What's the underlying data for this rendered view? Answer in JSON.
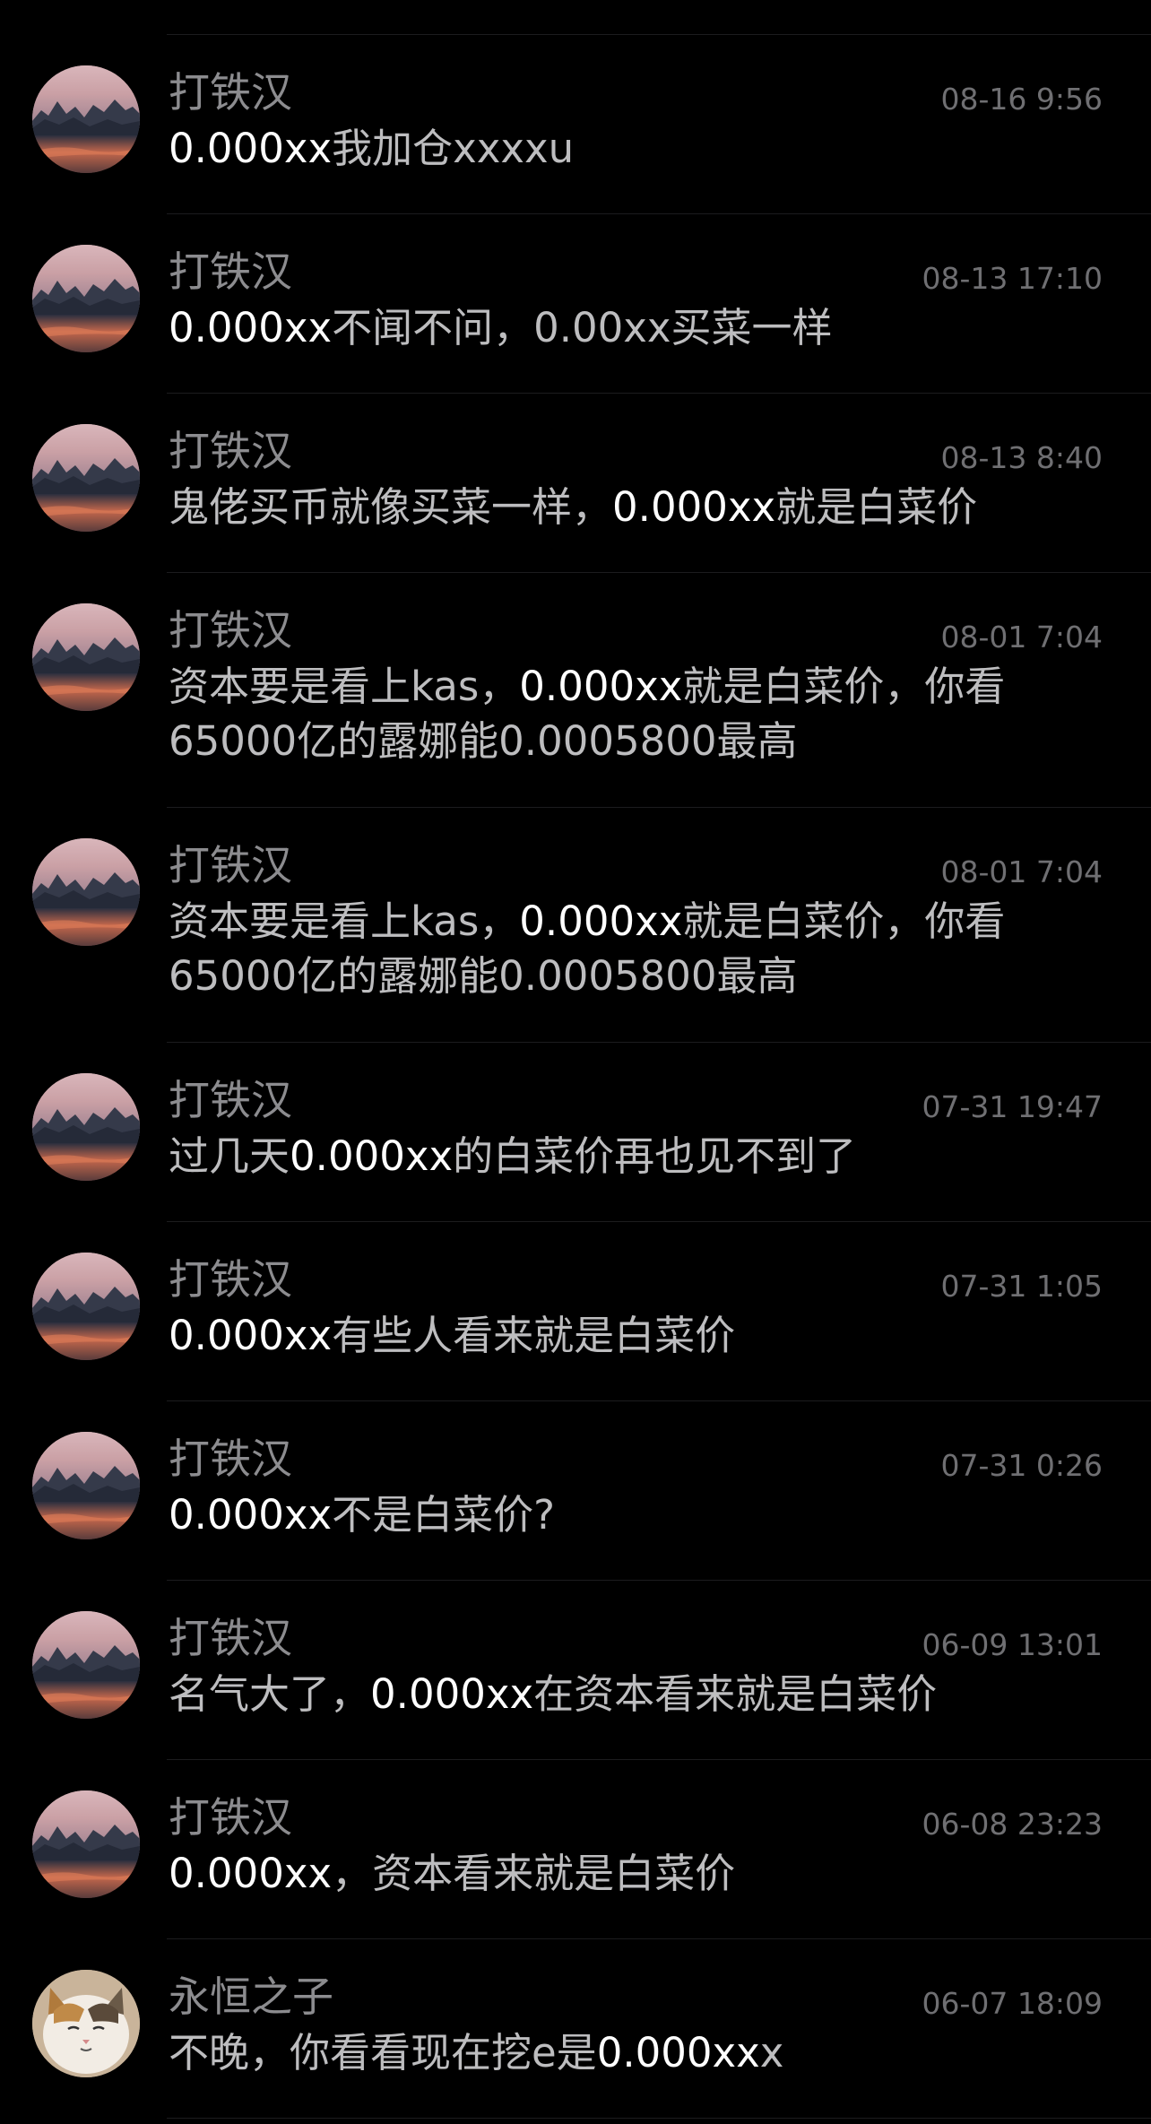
{
  "colors": {
    "background": "#000000",
    "divider": "#1c1c1e",
    "sender_text": "#8c8c8f",
    "time_text": "#6f6f72",
    "message_text": "#bdbdbf",
    "highlight_text": "#ffffff"
  },
  "messages": [
    {
      "sender": "打铁汉",
      "time": "08-16 9:56",
      "avatar": "landscape-avatar",
      "parts": [
        {
          "text": "0.000xx",
          "hl": true
        },
        {
          "text": "我加仓xxxxu",
          "hl": false
        }
      ]
    },
    {
      "sender": "打铁汉",
      "time": "08-13 17:10",
      "avatar": "landscape-avatar",
      "parts": [
        {
          "text": "0.000xx",
          "hl": true
        },
        {
          "text": "不闻不问，0.00xx买菜一样",
          "hl": false
        }
      ]
    },
    {
      "sender": "打铁汉",
      "time": "08-13 8:40",
      "avatar": "landscape-avatar",
      "parts": [
        {
          "text": "鬼佬买币就像买菜一样，",
          "hl": false
        },
        {
          "text": "0.000xx",
          "hl": true
        },
        {
          "text": "就是白菜价",
          "hl": false
        }
      ]
    },
    {
      "sender": "打铁汉",
      "time": "08-01 7:04",
      "avatar": "landscape-avatar",
      "parts": [
        {
          "text": "资本要是看上kas，",
          "hl": false
        },
        {
          "text": "0.000xx",
          "hl": true
        },
        {
          "text": "就是白菜价，你看65000亿的露娜能0.0005800最高",
          "hl": false
        }
      ]
    },
    {
      "sender": "打铁汉",
      "time": "08-01 7:04",
      "avatar": "landscape-avatar",
      "parts": [
        {
          "text": "资本要是看上kas，",
          "hl": false
        },
        {
          "text": "0.000xx",
          "hl": true
        },
        {
          "text": "就是白菜价，你看65000亿的露娜能0.0005800最高",
          "hl": false
        }
      ]
    },
    {
      "sender": "打铁汉",
      "time": "07-31 19:47",
      "avatar": "landscape-avatar",
      "parts": [
        {
          "text": "过几天",
          "hl": false
        },
        {
          "text": "0.000xx",
          "hl": true
        },
        {
          "text": "的白菜价再也见不到了",
          "hl": false
        }
      ]
    },
    {
      "sender": "打铁汉",
      "time": "07-31 1:05",
      "avatar": "landscape-avatar",
      "parts": [
        {
          "text": "0.000xx",
          "hl": true
        },
        {
          "text": "有些人看来就是白菜价",
          "hl": false
        }
      ]
    },
    {
      "sender": "打铁汉",
      "time": "07-31 0:26",
      "avatar": "landscape-avatar",
      "parts": [
        {
          "text": "0.000xx",
          "hl": true
        },
        {
          "text": "不是白菜价?",
          "hl": false
        }
      ]
    },
    {
      "sender": "打铁汉",
      "time": "06-09 13:01",
      "avatar": "landscape-avatar",
      "parts": [
        {
          "text": "名气大了，",
          "hl": false
        },
        {
          "text": "0.000xx",
          "hl": true
        },
        {
          "text": "在资本看来就是白菜价",
          "hl": false
        }
      ]
    },
    {
      "sender": "打铁汉",
      "time": "06-08 23:23",
      "avatar": "landscape-avatar",
      "parts": [
        {
          "text": "0.000xx",
          "hl": true
        },
        {
          "text": "，资本看来就是白菜价",
          "hl": false
        }
      ]
    },
    {
      "sender": "永恒之子",
      "time": "06-07 18:09",
      "avatar": "cat-avatar",
      "parts": [
        {
          "text": "不晚，你看看现在挖e是",
          "hl": false
        },
        {
          "text": "0.000xx",
          "hl": true
        },
        {
          "text": "x",
          "hl": false
        }
      ]
    }
  ]
}
